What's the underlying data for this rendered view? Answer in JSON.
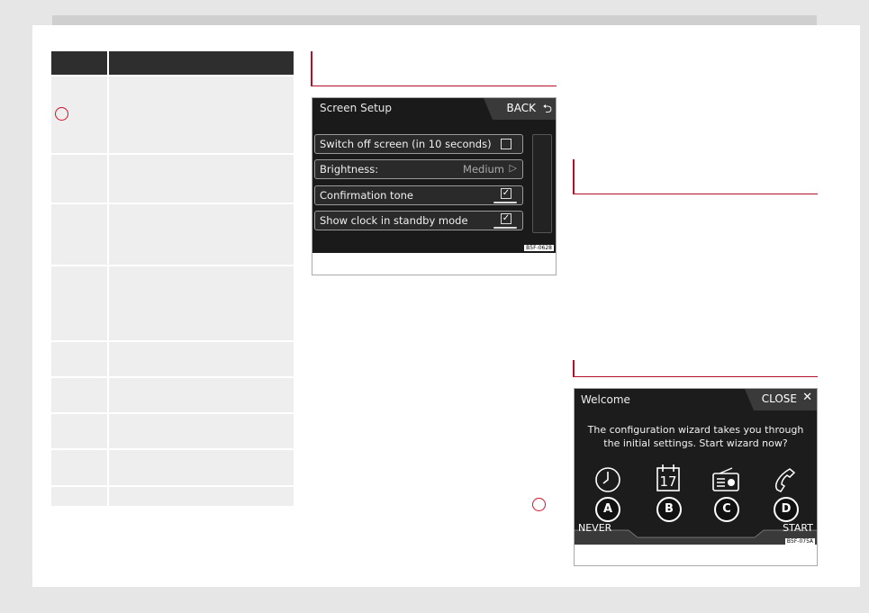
{
  "fig1": {
    "title": "Screen Setup",
    "back": "BACK",
    "options": [
      {
        "label": "Switch off screen (in 10 seconds)",
        "value": "",
        "checked": false
      },
      {
        "label": "Brightness:",
        "value": "Medium"
      },
      {
        "label": "Confirmation tone",
        "checked": true
      },
      {
        "label": "Show clock in standby mode",
        "checked": true
      }
    ],
    "code": "B5F-0628"
  },
  "fig2": {
    "title": "Welcome",
    "close": "CLOSE",
    "message_line1": "The configuration wizard takes you through",
    "message_line2": "the initial settings. Start wizard now?",
    "calendar_day": "17",
    "letters": [
      "A",
      "B",
      "C",
      "D"
    ],
    "never": "NEVER",
    "start": "START",
    "code": "B5F-075A"
  },
  "colors": {
    "accent": "#d6112a",
    "table_header": "#2e2e2e",
    "table_row": "#eeeeee"
  }
}
